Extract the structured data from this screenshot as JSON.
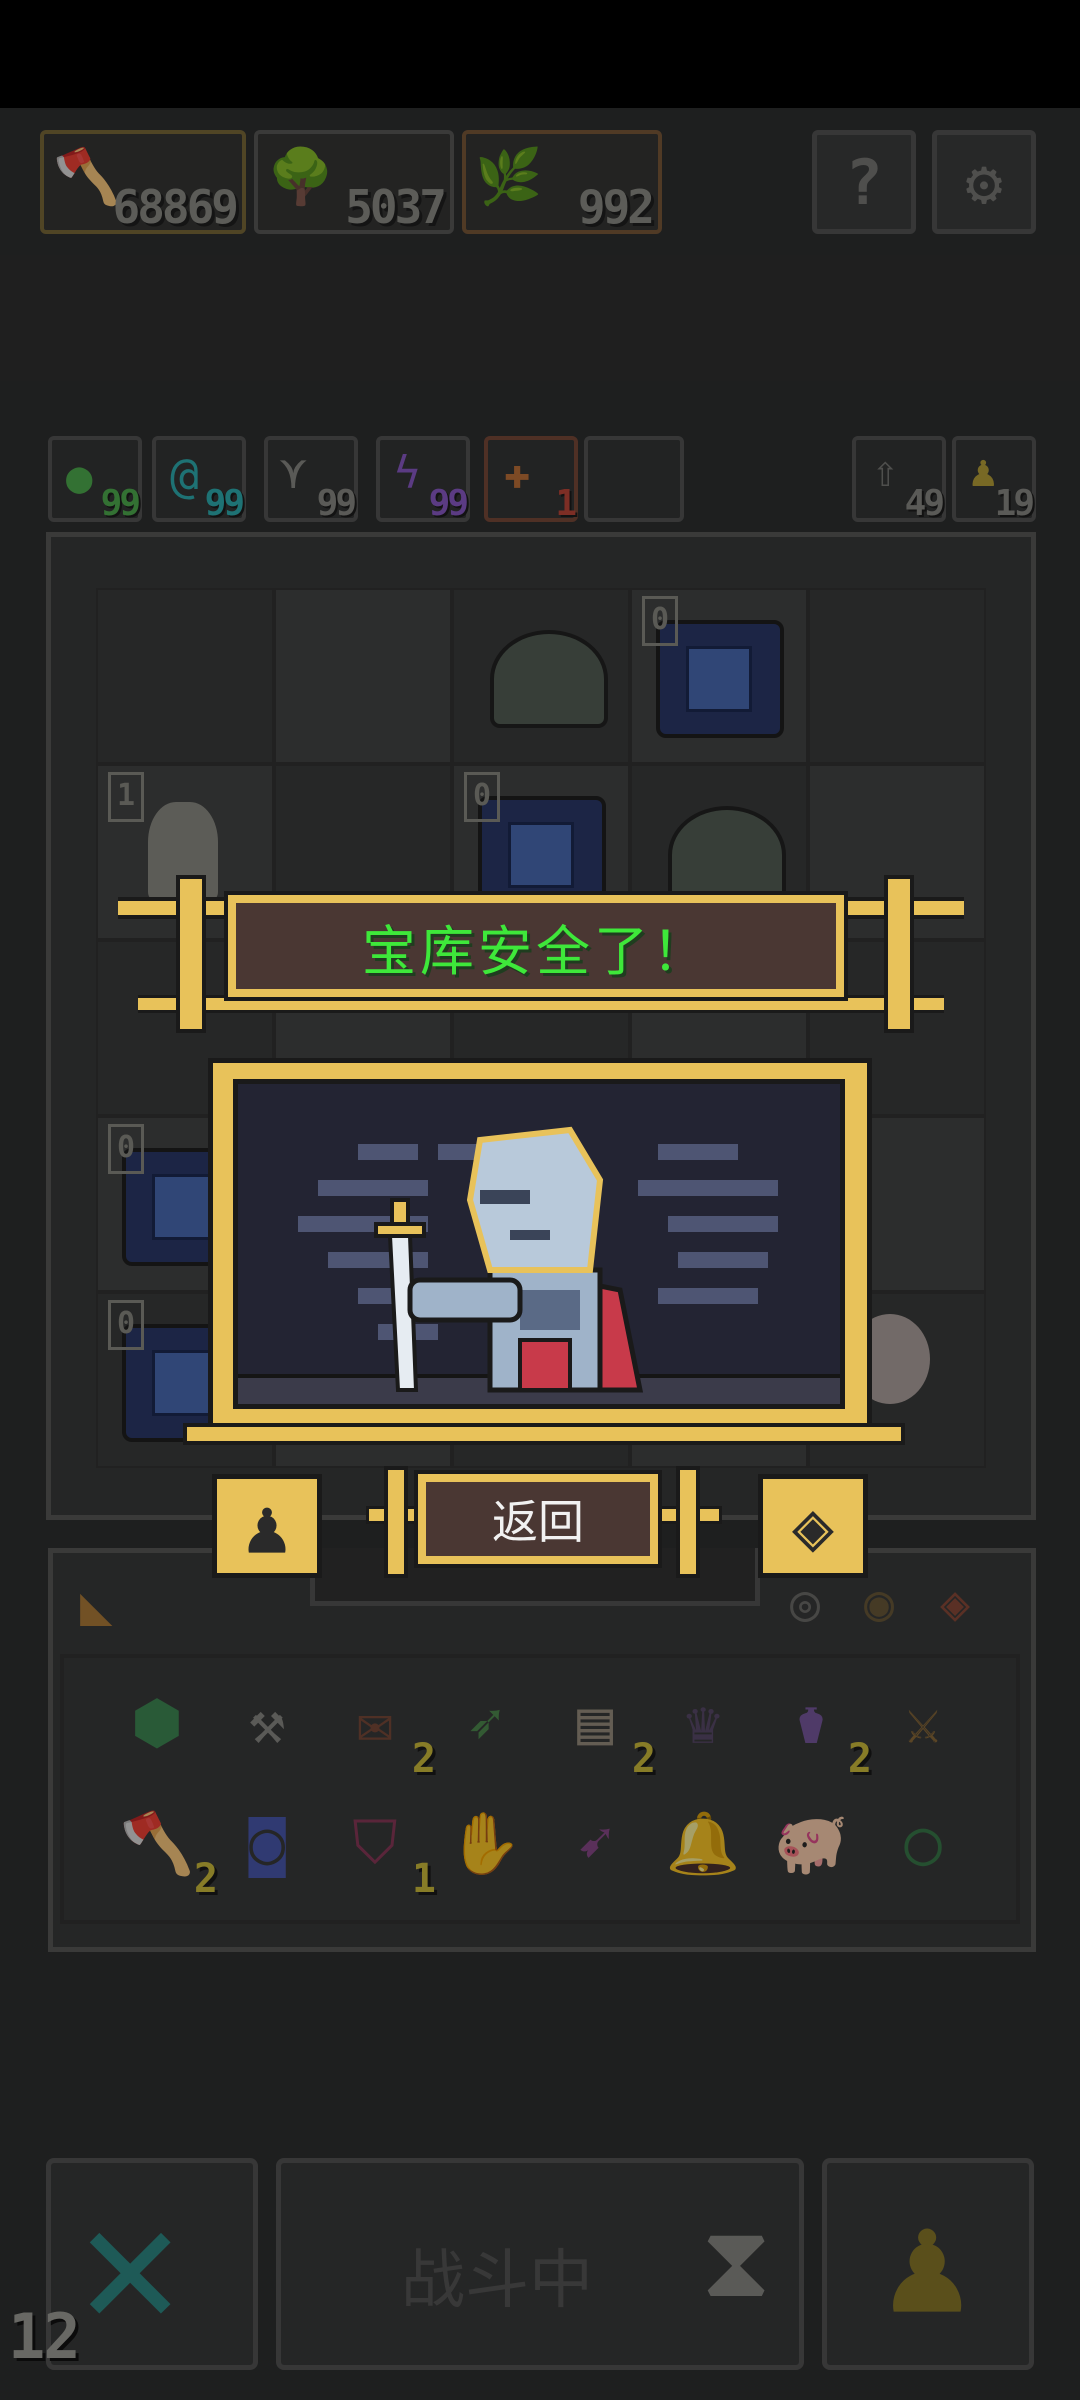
{
  "resources": [
    {
      "icon": "axe-icon",
      "value": "68869"
    },
    {
      "icon": "tree-icon",
      "value": "5037"
    },
    {
      "icon": "bush-icon",
      "value": "992"
    }
  ],
  "top_buttons": {
    "help": "?",
    "settings": "gear-icon"
  },
  "buffs": [
    {
      "icon": "green-orb-icon",
      "value": "99",
      "color": "#4fae4f"
    },
    {
      "icon": "spiral-icon",
      "value": "99",
      "color": "#2fb0b3"
    },
    {
      "icon": "wing-icon",
      "value": "99",
      "color": "#8a8a86"
    },
    {
      "icon": "lightning-icon",
      "value": "99",
      "color": "#8c5bc9"
    },
    {
      "icon": "fire-icon",
      "value": "1",
      "color": "#c0473a"
    }
  ],
  "side_counters": [
    {
      "icon": "arrow-up-icon",
      "value": "49"
    },
    {
      "icon": "pawn-icon",
      "value": "19"
    }
  ],
  "board_badges": [
    "0",
    "1",
    "0",
    "0",
    "0"
  ],
  "modal": {
    "title": "宝库安全了！",
    "return_label": "返回",
    "colors": {
      "gold": "#e8c25a",
      "plaque": "#4a3733",
      "title_text": "#3ee83a"
    }
  },
  "inventory": {
    "row1": [
      {
        "icon": "turtle-shell-icon",
        "qty": ""
      },
      {
        "icon": "hammer-icon",
        "qty": ""
      },
      {
        "icon": "scroll-icon",
        "qty": "2"
      },
      {
        "icon": "arrow-icon",
        "qty": ""
      },
      {
        "icon": "parchment-icon",
        "qty": "2"
      },
      {
        "icon": "crown-icon",
        "qty": ""
      },
      {
        "icon": "potion-icon",
        "qty": "2"
      },
      {
        "icon": "fence-icon",
        "qty": ""
      }
    ],
    "row2": [
      {
        "icon": "axe-icon",
        "qty": "2"
      },
      {
        "icon": "rune-icon",
        "qty": ""
      },
      {
        "icon": "shield-icon",
        "qty": "1"
      },
      {
        "icon": "gauntlet-icon",
        "qty": ""
      },
      {
        "icon": "dart-icon",
        "qty": ""
      },
      {
        "icon": "bell-icon",
        "qty": ""
      },
      {
        "icon": "pig-icon",
        "qty": ""
      },
      {
        "icon": "ring-icon",
        "qty": ""
      }
    ]
  },
  "bottom_bar": {
    "battle_label": "战斗中",
    "counter": "12"
  }
}
